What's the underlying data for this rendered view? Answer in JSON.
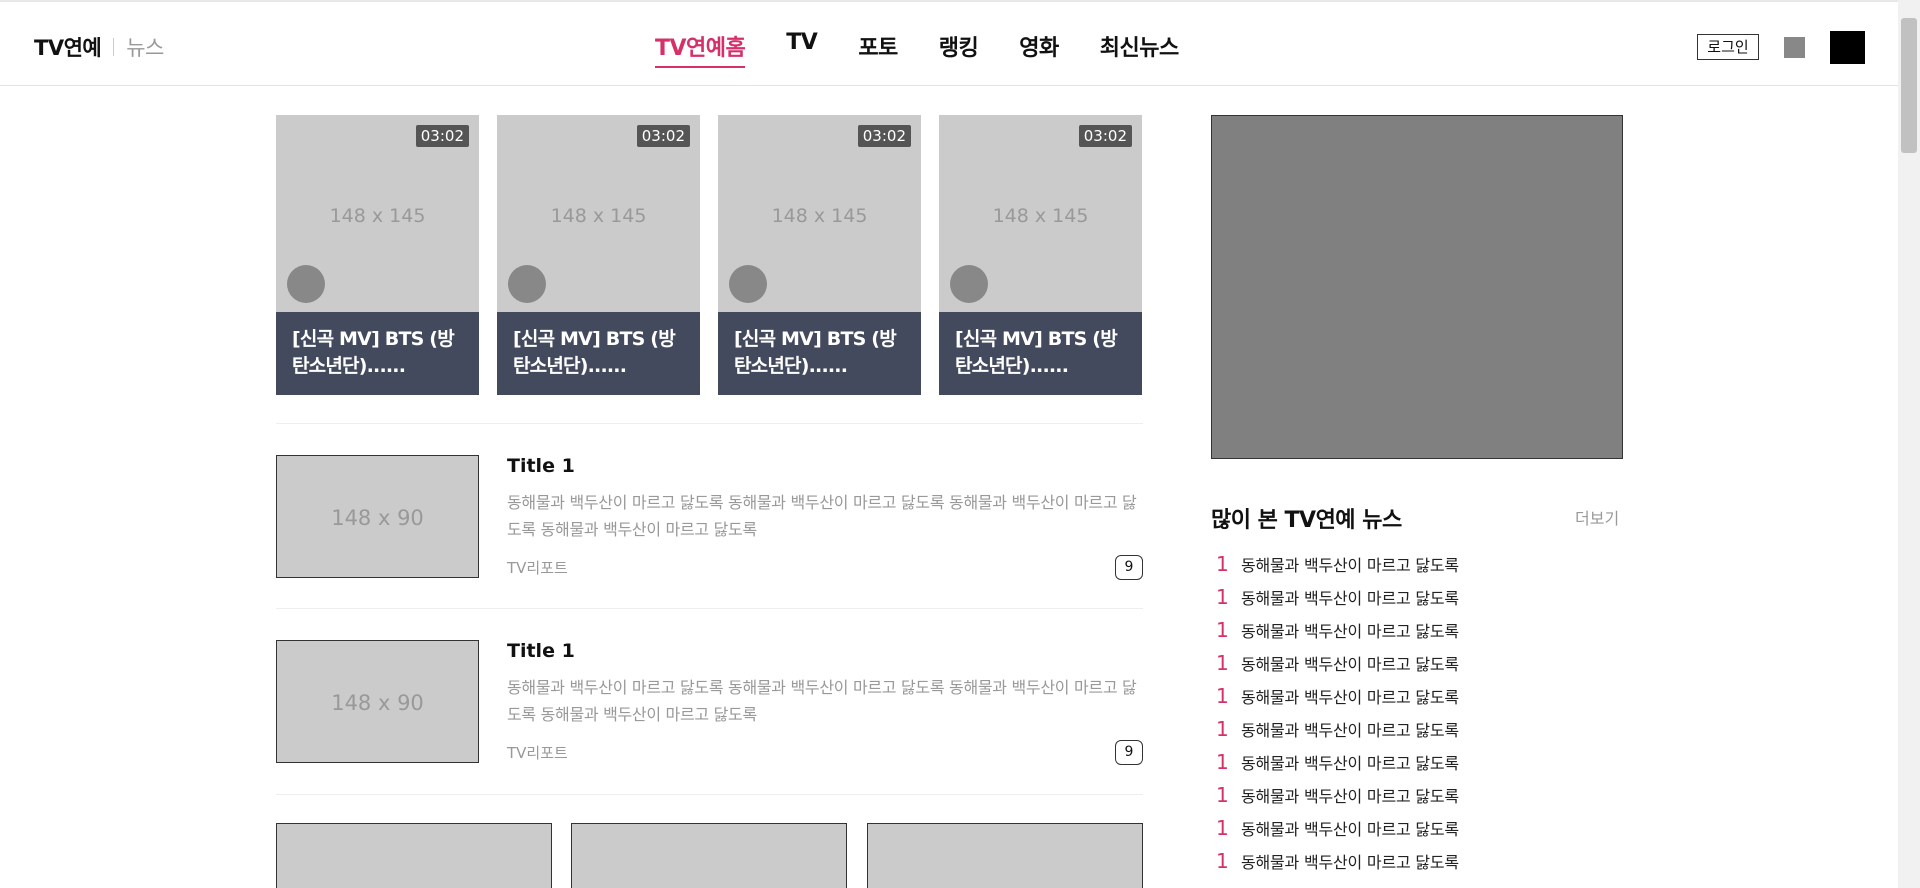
{
  "header": {
    "logo_main": "TV연예",
    "logo_sub": "뉴스",
    "nav": [
      "TV연예홈",
      "TV",
      "포토",
      "랭킹",
      "영화",
      "최신뉴스"
    ],
    "active_nav": "TV연예홈",
    "login_label": "로그인"
  },
  "video_cards": [
    {
      "duration": "03:02",
      "placeholder": "148 x 145",
      "caption": "[신곡 MV] BTS (방탄소년단)......"
    },
    {
      "duration": "03:02",
      "placeholder": "148 x 145",
      "caption": "[신곡 MV] BTS (방탄소년단)......"
    },
    {
      "duration": "03:02",
      "placeholder": "148 x 145",
      "caption": "[신곡 MV] BTS (방탄소년단)......"
    },
    {
      "duration": "03:02",
      "placeholder": "148 x 145",
      "caption": "[신곡 MV] BTS (방탄소년단)......"
    }
  ],
  "news": [
    {
      "title": "Title 1",
      "placeholder": "148 x 90",
      "desc": "동해물과 백두산이 마르고 닳도록 동해물과 백두산이 마르고 닳도록 동해물과 백두산이 마르고 닳도록 동해물과 백두산이 마르고 닳도록",
      "source": "TV리포트",
      "count": "9"
    },
    {
      "title": "Title 1",
      "placeholder": "148 x 90",
      "desc": "동해물과 백두산이 마르고 닳도록 동해물과 백두산이 마르고 닳도록 동해물과 백두산이 마르고 닳도록 동해물과 백두산이 마르고 닳도록",
      "source": "TV리포트",
      "count": "9"
    }
  ],
  "sidebar": {
    "popular_title": "많이 본 TV연예 뉴스",
    "more_label": "더보기",
    "items": [
      {
        "rank": "1",
        "text": "동해물과 백두산이 마르고 닳도록"
      },
      {
        "rank": "1",
        "text": "동해물과 백두산이 마르고 닳도록"
      },
      {
        "rank": "1",
        "text": "동해물과 백두산이 마르고 닳도록"
      },
      {
        "rank": "1",
        "text": "동해물과 백두산이 마르고 닳도록"
      },
      {
        "rank": "1",
        "text": "동해물과 백두산이 마르고 닳도록"
      },
      {
        "rank": "1",
        "text": "동해물과 백두산이 마르고 닳도록"
      },
      {
        "rank": "1",
        "text": "동해물과 백두산이 마르고 닳도록"
      },
      {
        "rank": "1",
        "text": "동해물과 백두산이 마르고 닳도록"
      },
      {
        "rank": "1",
        "text": "동해물과 백두산이 마르고 닳도록"
      },
      {
        "rank": "1",
        "text": "동해물과 백두산이 마르고 닳도록"
      }
    ]
  },
  "colors": {
    "accent": "#d6306a",
    "caption_bg": "#444a5e",
    "placeholder_bg": "#cbcbcb",
    "ad_bg": "#808080"
  }
}
